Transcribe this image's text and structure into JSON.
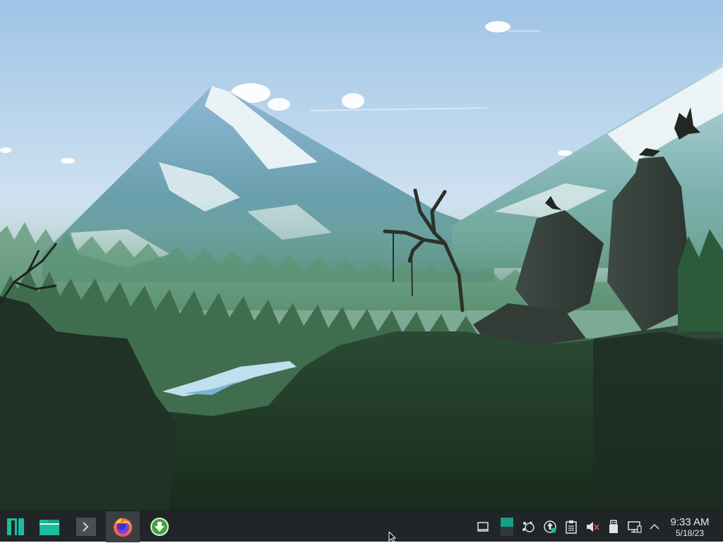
{
  "desktop": {
    "wallpaper": "forest-mountain-landscape"
  },
  "taskbar": {
    "launcher": {
      "icon": "manjaro-logo-icon"
    },
    "apps": [
      {
        "name": "file-manager",
        "icon": "folder-icon"
      },
      {
        "name": "terminal",
        "icon": "terminal-icon"
      },
      {
        "name": "firefox",
        "icon": "firefox-icon",
        "active": true
      },
      {
        "name": "software-updater",
        "icon": "download-icon"
      }
    ],
    "tray": [
      {
        "icon": "show-desktop-icon"
      },
      {
        "icon": "virtual-desktop-pager-icon"
      },
      {
        "icon": "kde-connect-icon"
      },
      {
        "icon": "updates-icon"
      },
      {
        "icon": "clipboard-icon"
      },
      {
        "icon": "volume-muted-icon"
      },
      {
        "icon": "usb-device-icon"
      },
      {
        "icon": "network-icon"
      },
      {
        "icon": "expand-tray-icon"
      }
    ],
    "clock": {
      "time": "9:33 AM",
      "date": "5/18/23"
    }
  },
  "colors": {
    "taskbar_bg": "#222528",
    "accent": "#1abc9c",
    "active_task_bg": "#3b3f44"
  }
}
